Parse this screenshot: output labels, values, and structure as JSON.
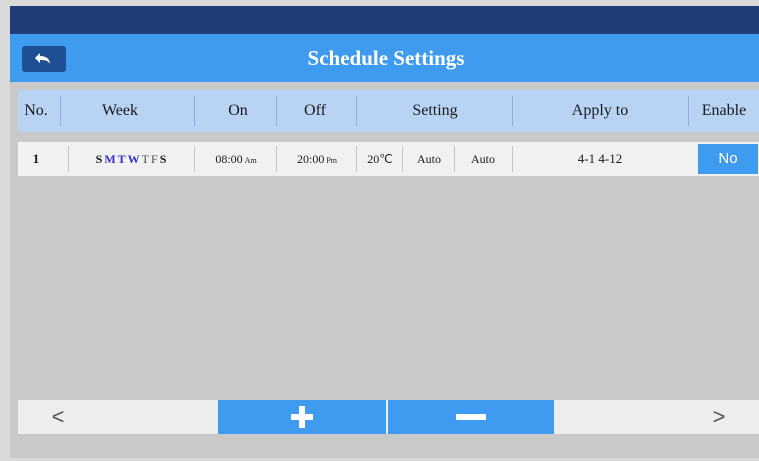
{
  "colors": {
    "top_bar": "#1f3e78",
    "title_bar": "#3f9bf0",
    "accent": "#3f9bf0",
    "header_row": "#b9d3f5",
    "weekday_selected": "#2e35c8",
    "weekday_unselected": "#1a1a1a",
    "background": "#c9c9c9"
  },
  "header": {
    "title": "Schedule Settings",
    "back_icon": "back-arrow-icon"
  },
  "table": {
    "columns": [
      "No.",
      "Week",
      "On",
      "Off",
      "Setting",
      "Apply to",
      "Enable"
    ],
    "rows": [
      {
        "no": "1",
        "week": [
          {
            "day": "S",
            "selected": false
          },
          {
            "day": "M",
            "selected": true
          },
          {
            "day": "T",
            "selected": true
          },
          {
            "day": "W",
            "selected": true
          },
          {
            "day": "T",
            "selected": false
          },
          {
            "day": "F",
            "selected": false
          },
          {
            "day": "S",
            "selected": false
          }
        ],
        "on_time": "08:00",
        "on_ampm": "Am",
        "off_time": "20:00",
        "off_ampm": "Pm",
        "temperature": "20℃",
        "mode": "Auto",
        "fan": "Auto",
        "apply_to": "4-1 4-12",
        "enable": "No"
      }
    ]
  },
  "bottom": {
    "prev_label": "<",
    "next_label": ">",
    "add_icon": "plus-icon",
    "remove_icon": "minus-icon"
  }
}
